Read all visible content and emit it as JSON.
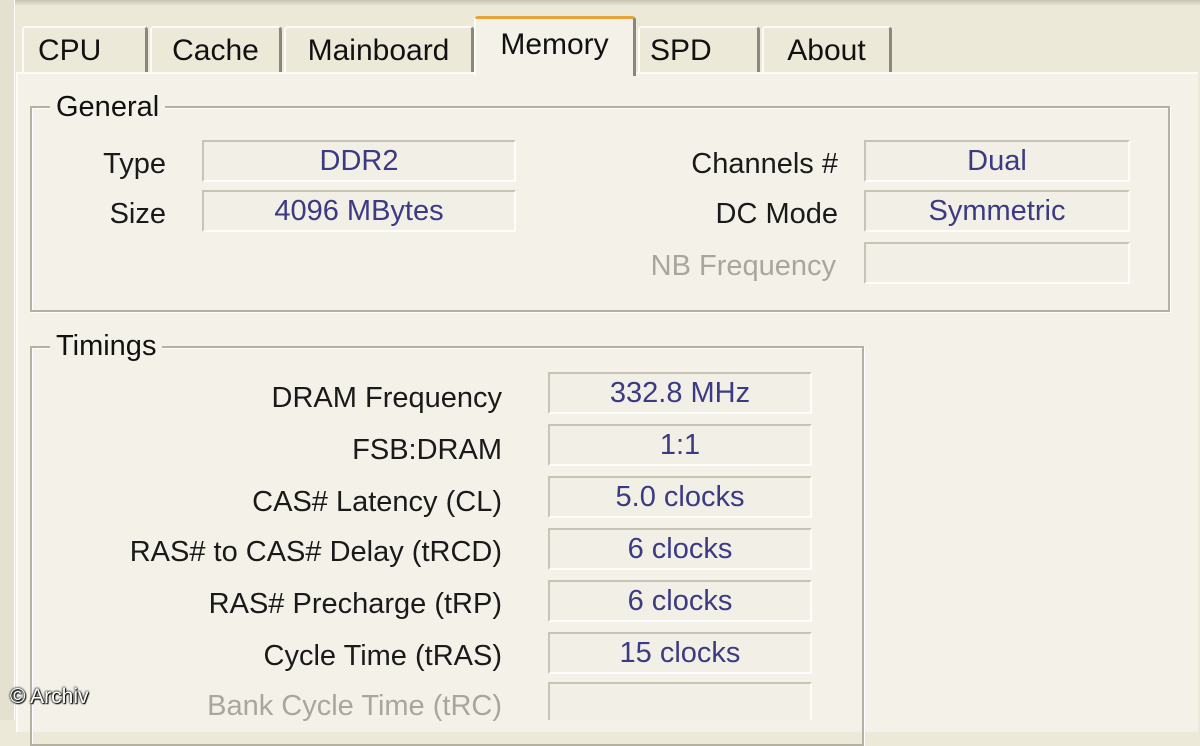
{
  "tabs": [
    "CPU",
    "Cache",
    "Mainboard",
    "Memory",
    "SPD",
    "About"
  ],
  "active_tab": "Memory",
  "general": {
    "title": "General",
    "type_label": "Type",
    "type_value": "DDR2",
    "size_label": "Size",
    "size_value": "4096 MBytes",
    "channels_label": "Channels #",
    "channels_value": "Dual",
    "dc_mode_label": "DC Mode",
    "dc_mode_value": "Symmetric",
    "nb_frequency_label": "NB Frequency",
    "nb_frequency_value": ""
  },
  "timings": {
    "title": "Timings",
    "rows": [
      {
        "label": "DRAM Frequency",
        "value": "332.8 MHz"
      },
      {
        "label": "FSB:DRAM",
        "value": "1:1"
      },
      {
        "label": "CAS# Latency (CL)",
        "value": "5.0 clocks"
      },
      {
        "label": "RAS# to CAS# Delay (tRCD)",
        "value": "6 clocks"
      },
      {
        "label": "RAS# Precharge (tRP)",
        "value": "6 clocks"
      },
      {
        "label": "Cycle Time (tRAS)",
        "value": "15 clocks"
      },
      {
        "label": "Bank Cycle Time (tRC)",
        "value": ""
      }
    ]
  },
  "watermark": "© Archiv",
  "colors": {
    "value_text": "#3c3a82",
    "active_tab_accent": "#e8a33a",
    "disabled_text": "#a9a79d"
  }
}
